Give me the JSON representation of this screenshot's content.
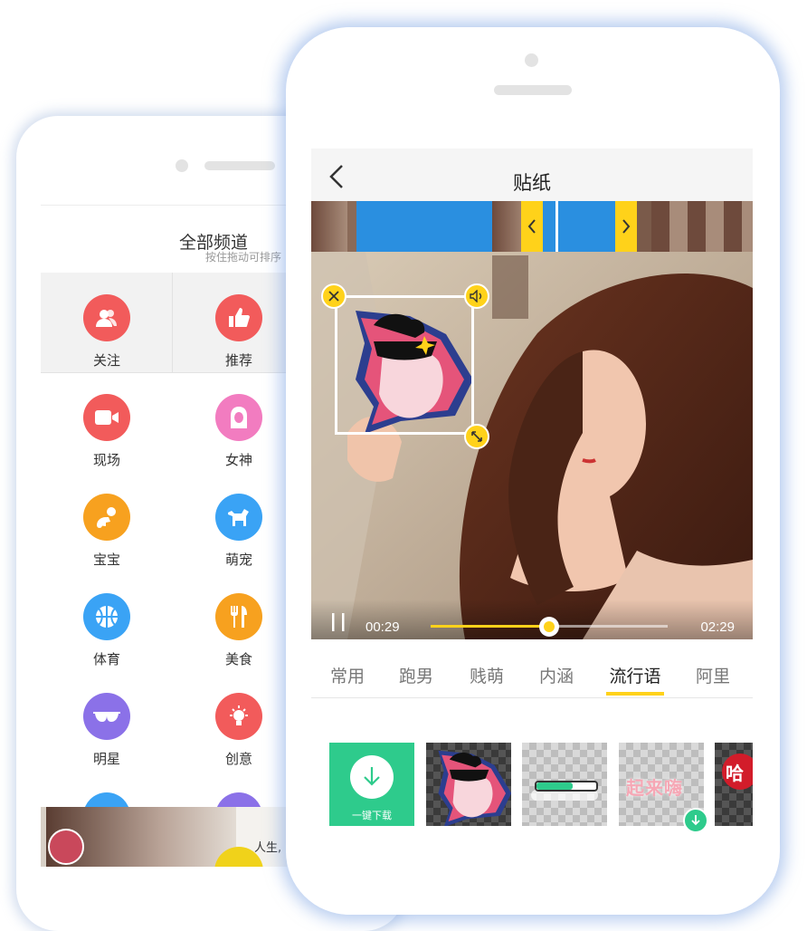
{
  "back_phone": {
    "channels_title": "全部频道",
    "channels_hint": "按住拖动可排序",
    "channels": [
      {
        "label": "关注",
        "icon": "users-icon",
        "color": "#f25b5b"
      },
      {
        "label": "推荐",
        "icon": "thumbs-up-icon",
        "color": "#f25b5b"
      },
      {
        "label": "现场",
        "icon": "video-camera-icon",
        "color": "#f25b5b"
      },
      {
        "label": "女神",
        "icon": "woman-icon",
        "color": "#f27cc0"
      },
      {
        "label": "宝宝",
        "icon": "baby-icon",
        "color": "#f7a11f"
      },
      {
        "label": "萌宠",
        "icon": "dog-icon",
        "color": "#3aa3f5"
      },
      {
        "label": "体育",
        "icon": "basketball-icon",
        "color": "#3aa3f5"
      },
      {
        "label": "美食",
        "icon": "fork-knife-icon",
        "color": "#f7a11f"
      },
      {
        "label": "明星",
        "icon": "sunglasses-icon",
        "color": "#8b71e8"
      },
      {
        "label": "创意",
        "icon": "lightbulb-icon",
        "color": "#f25b5b"
      }
    ],
    "bottom_snippet": "人生,"
  },
  "front_phone": {
    "title": "贴纸",
    "player": {
      "current_time": "00:29",
      "total_time": "02:29",
      "progress": 0.5
    },
    "tabs": [
      {
        "label": "常用",
        "active": false
      },
      {
        "label": "跑男",
        "active": false
      },
      {
        "label": "贱萌",
        "active": false
      },
      {
        "label": "内涵",
        "active": false
      },
      {
        "label": "流行语",
        "active": true
      },
      {
        "label": "阿里",
        "active": false
      }
    ],
    "download_all_label": "一键下载",
    "sticker_texts": [
      "起来嗨",
      "哈"
    ],
    "accent_color": "#ffd21a",
    "download_color": "#2ecb8c"
  }
}
